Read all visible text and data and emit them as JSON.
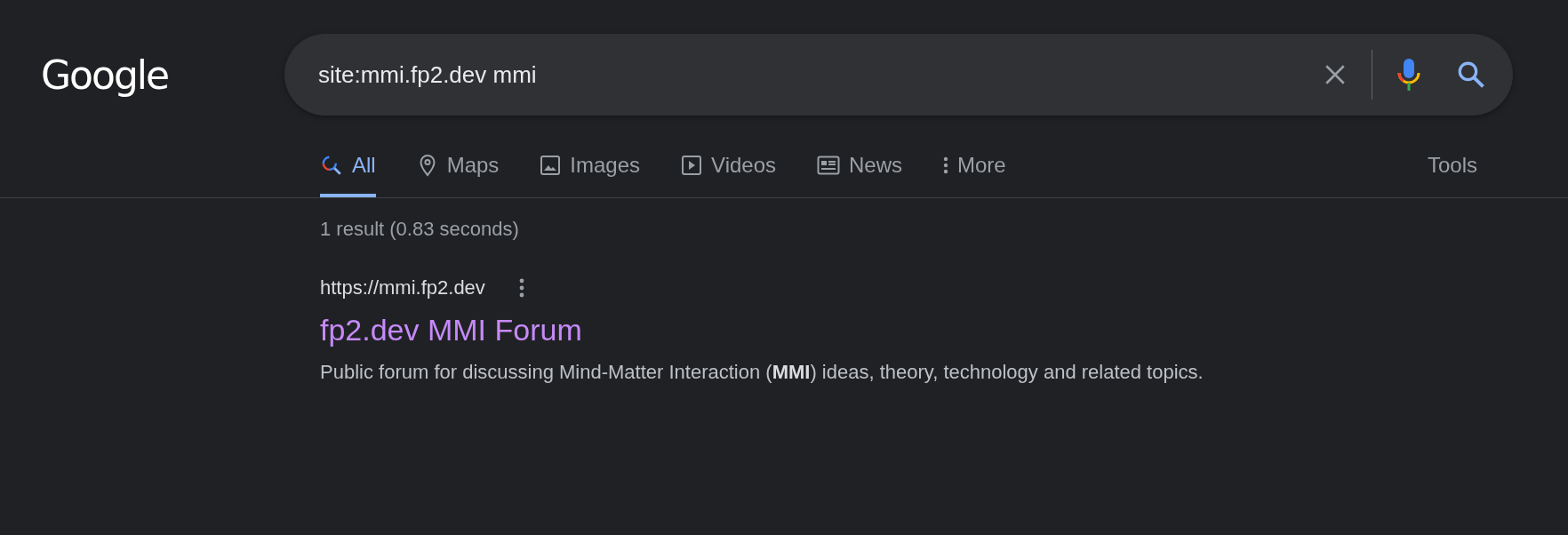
{
  "logo": "Google",
  "search": {
    "value": "site:mmi.fp2.dev mmi"
  },
  "tabs": [
    {
      "label": "All",
      "kind": "all",
      "selected": true
    },
    {
      "label": "Maps",
      "kind": "maps",
      "selected": false
    },
    {
      "label": "Images",
      "kind": "images",
      "selected": false
    },
    {
      "label": "Videos",
      "kind": "videos",
      "selected": false
    },
    {
      "label": "News",
      "kind": "news",
      "selected": false
    },
    {
      "label": "More",
      "kind": "more",
      "selected": false
    }
  ],
  "tools": "Tools",
  "result_stats": "1 result (0.83 seconds)",
  "results": [
    {
      "url": "https://mmi.fp2.dev",
      "title": "fp2.dev MMI Forum",
      "snippet": "Public forum for discussing Mind-Matter Interaction (**MMI**) ideas, theory, technology and related topics."
    }
  ]
}
